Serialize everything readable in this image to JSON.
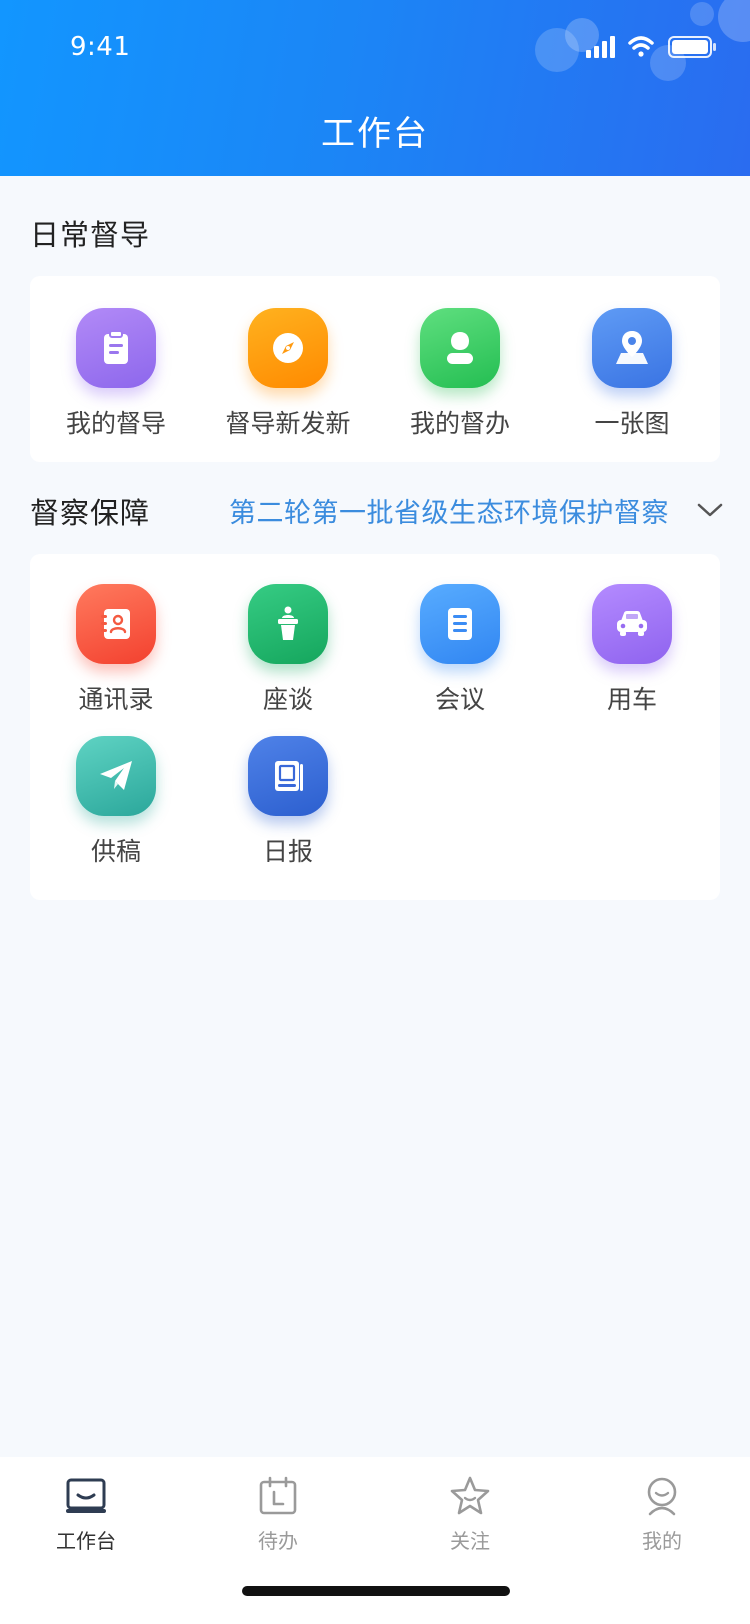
{
  "status_bar": {
    "time": "9:41"
  },
  "header": {
    "title": "工作台"
  },
  "daily_supervision": {
    "title": "日常督导",
    "items": [
      {
        "label": "我的督导",
        "icon": "clipboard-icon"
      },
      {
        "label": "督导新发新",
        "icon": "compass-icon"
      },
      {
        "label": "我的督办",
        "icon": "user-icon"
      },
      {
        "label": "一张图",
        "icon": "map-pin-icon"
      }
    ]
  },
  "inspection_support": {
    "title": "督察保障",
    "selected_session": "第二轮第一批省级生态环境保护督察",
    "items": [
      {
        "label": "通讯录",
        "icon": "contacts-book-icon"
      },
      {
        "label": "座谈",
        "icon": "podium-icon"
      },
      {
        "label": "会议",
        "icon": "document-icon"
      },
      {
        "label": "用车",
        "icon": "car-icon"
      },
      {
        "label": "供稿",
        "icon": "paper-plane-icon"
      },
      {
        "label": "日报",
        "icon": "report-book-icon"
      }
    ]
  },
  "tabbar": {
    "tabs": [
      {
        "label": "工作台",
        "icon": "workbench-icon",
        "active": true
      },
      {
        "label": "待办",
        "icon": "calendar-icon",
        "active": false
      },
      {
        "label": "关注",
        "icon": "star-icon",
        "active": false
      },
      {
        "label": "我的",
        "icon": "profile-icon",
        "active": false
      }
    ]
  },
  "colors": {
    "header_start": "#1296ff",
    "header_end": "#2a6cf0",
    "accent_link": "#3b8cde",
    "page_background": "#f6f9fd",
    "tab_active": "#333333",
    "tab_inactive": "#9a9a9a"
  }
}
